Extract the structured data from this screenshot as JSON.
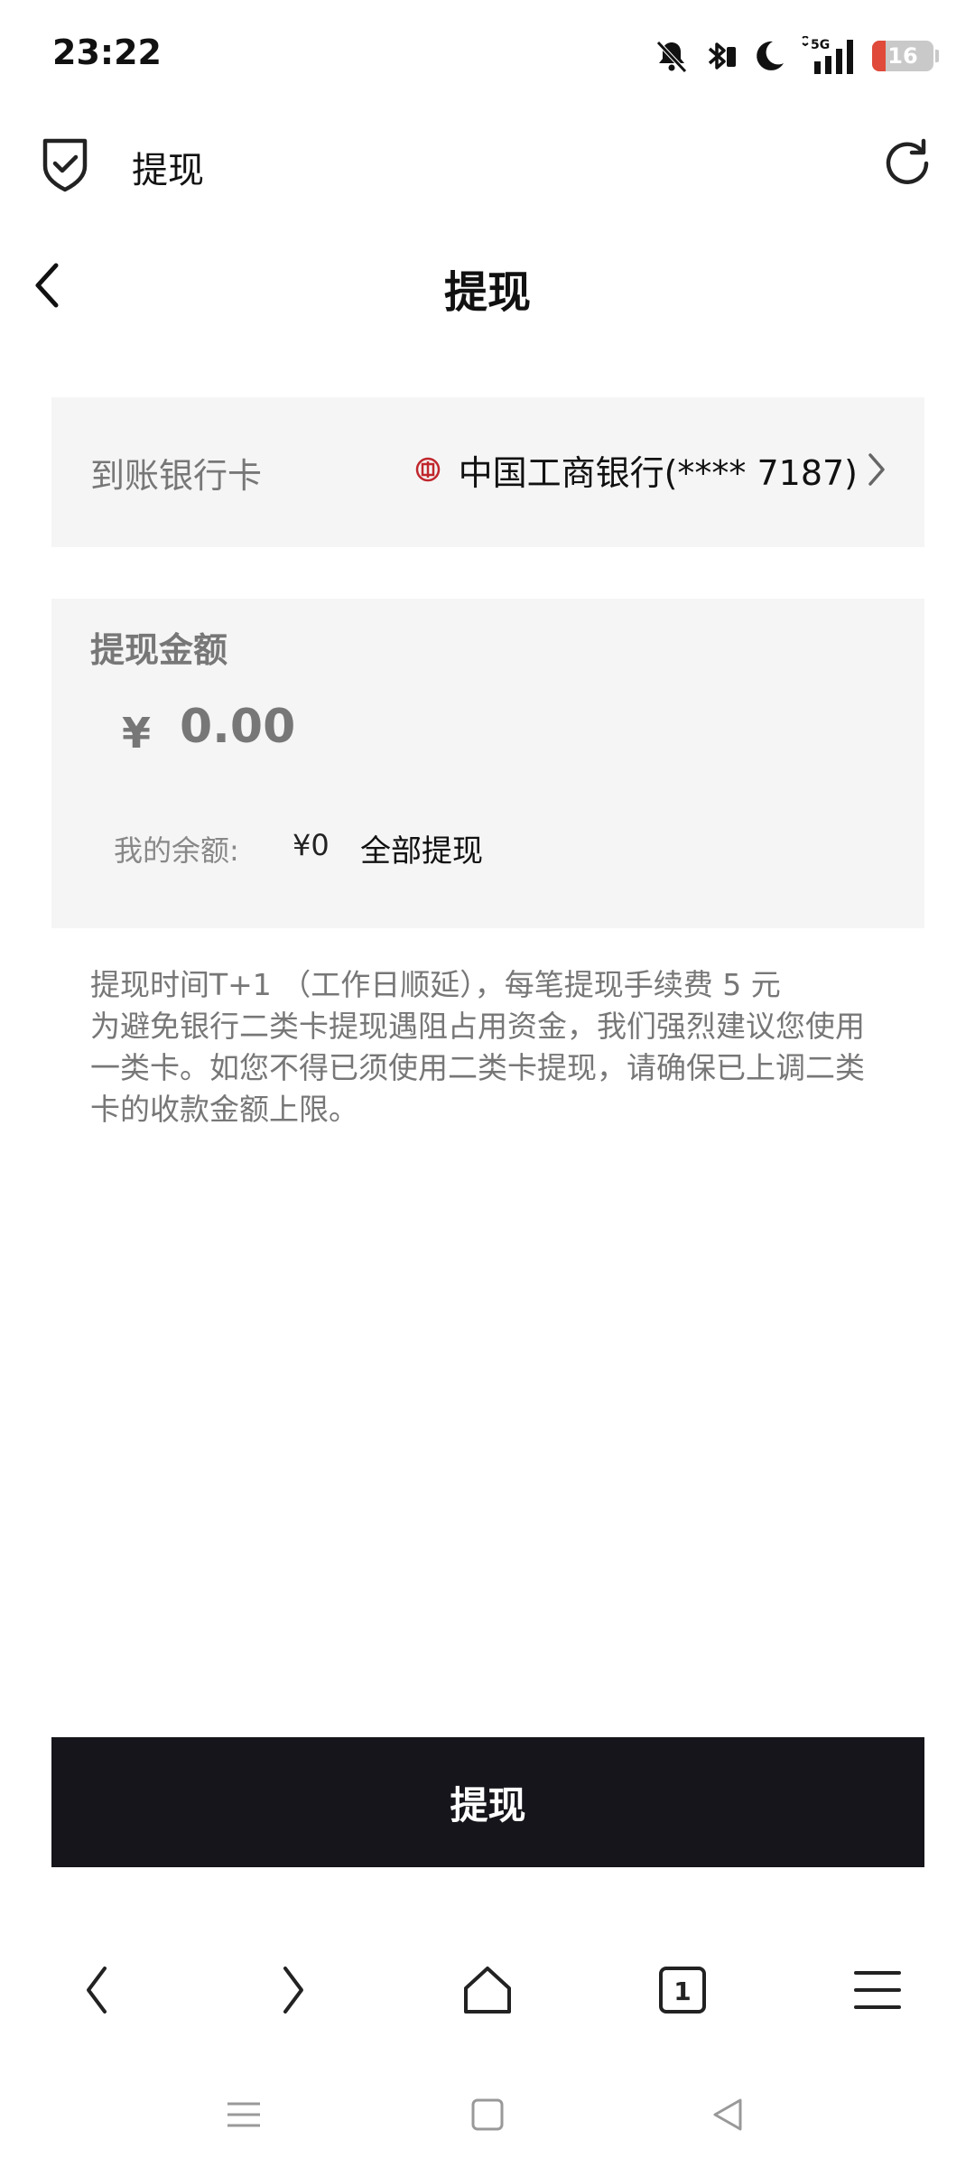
{
  "status_bar": {
    "time": "23:22",
    "network": "5G",
    "battery": "16",
    "icons": [
      "bell-muted-icon",
      "bluetooth-icon",
      "moon-icon",
      "signal-icon",
      "battery-icon"
    ]
  },
  "browser": {
    "title": "提现",
    "icons": [
      "shield-check-icon",
      "refresh-icon"
    ]
  },
  "page": {
    "title": "提现"
  },
  "bank": {
    "label": "到账银行卡",
    "name": "中国工商银行(**** 7187)",
    "logo_color": "#c0272d"
  },
  "amount": {
    "label": "提现金额",
    "currency": "¥",
    "value": "0.00",
    "balance_label": "我的余额:",
    "balance_value": "¥0",
    "withdraw_all": "全部提现"
  },
  "notes": [
    "提现时间T+1 （工作日顺延），每笔提现手续费 5 元",
    "为避免银行二类卡提现遇阻占用资金，我们强烈建议您使用",
    "一类卡。如您不得已须使用二类卡提现，请确保已上调二类",
    "卡的收款金额上限。"
  ],
  "submit": {
    "label": "提现",
    "color": "#16151b"
  },
  "bottom_nav": {
    "tab_count": "1",
    "icons": [
      "back-icon",
      "forward-icon",
      "home-icon",
      "tabs-icon",
      "menu-icon"
    ]
  },
  "system_nav": {
    "icons": [
      "recents-icon",
      "home-square-icon",
      "back-triangle-icon"
    ]
  }
}
